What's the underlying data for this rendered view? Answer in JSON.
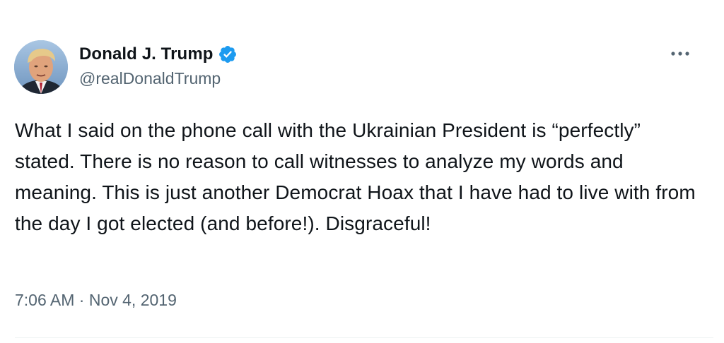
{
  "tweet": {
    "author": {
      "display_name": "Donald J. Trump",
      "handle": "@realDonaldTrump",
      "verified": true,
      "verified_color": "#1d9bf0"
    },
    "more_icon": "more-horizontal-icon",
    "text": "What I said on the phone call with the Ukrainian President is “perfectly” stated. There is no reason to call witnesses to analyze my words and meaning. This is just another Democrat Hoax that I have had to live with from the day I got elected (and before!). Disgraceful!",
    "time": "7:06 AM",
    "separator": "·",
    "date": "Nov 4, 2019"
  },
  "colors": {
    "text_primary": "#0f1419",
    "text_secondary": "#536471",
    "accent": "#1d9bf0"
  }
}
